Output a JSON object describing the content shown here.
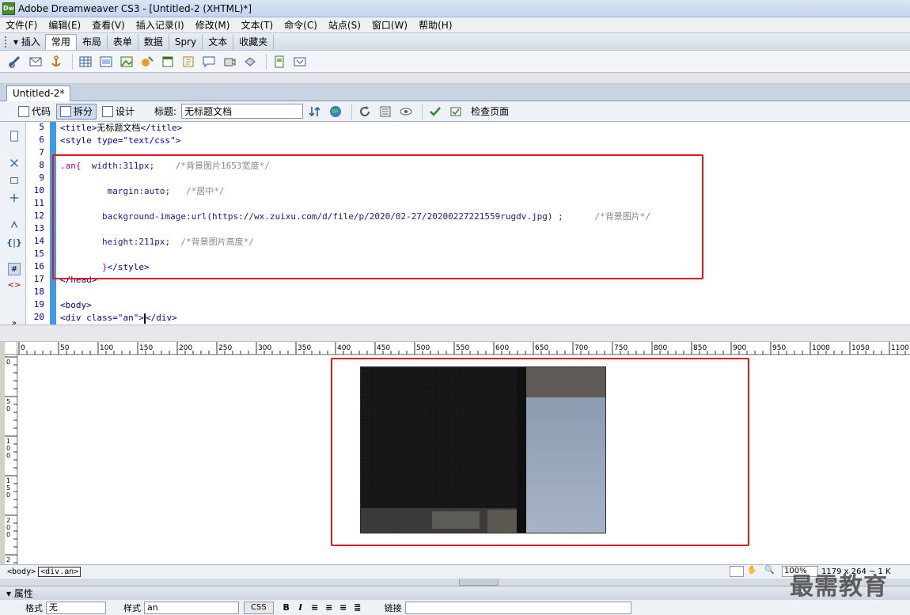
{
  "window": {
    "title": "Adobe Dreamweaver CS3 - [Untitled-2 (XHTML)*]",
    "icon_text": "Dw"
  },
  "menu": [
    "文件(F)",
    "编辑(E)",
    "查看(V)",
    "插入记录(I)",
    "修改(M)",
    "文本(T)",
    "命令(C)",
    "站点(S)",
    "窗口(W)",
    "帮助(H)"
  ],
  "insert_panel": {
    "label": "▾ 插入",
    "tabs": [
      "常用",
      "布局",
      "表单",
      "数据",
      "Spry",
      "文本",
      "收藏夹"
    ],
    "active_tab": "常用"
  },
  "document": {
    "tab": "Untitled-2*",
    "views": {
      "code": "代码",
      "split": "拆分",
      "design": "设计"
    },
    "title_label": "标题:",
    "title_value": "无标题文档",
    "check_page": "检查页面"
  },
  "code": {
    "line_numbers": [
      "5",
      "6",
      "7",
      "8",
      "9",
      "10",
      "11",
      "12",
      "13",
      "14",
      "15",
      "16",
      "17",
      "18",
      "19",
      "20"
    ],
    "lines": {
      "l5": {
        "open": "<title>",
        "text": "无标题文档",
        "close": "</title>"
      },
      "l6": {
        "open": "<style ",
        "attr": "type=",
        "val": "\"text/css\"",
        "end": ">"
      },
      "l8": {
        "sel": ".an{  ",
        "prop": "width:311px;",
        "cmt": "    /*背景图片1653宽度*/"
      },
      "l10": {
        "prop": "         margin:auto;",
        "cmt": "   /*居中*/"
      },
      "l12": {
        "prop": "        background-image:url(https://wx.zuixu.com/d/file/p/2020/02-27/20200227221559rugdv.jpg) ;",
        "cmt": "      /*背景图片*/"
      },
      "l14": {
        "prop": "        height:211px;",
        "cmt": "  /*背景图片高度*/"
      },
      "l16": {
        "sel": "        }",
        "close": "</style>"
      },
      "l17": "</head>",
      "l19": "<body>",
      "l20": {
        "open": "<div class=",
        "val": "\"an\"",
        "mid": ">",
        "close": "</div>"
      }
    }
  },
  "ruler": {
    "h_labels": [
      "0",
      "50",
      "100",
      "150",
      "200",
      "250",
      "300",
      "350",
      "400",
      "450",
      "500",
      "550",
      "600",
      "650",
      "700",
      "750",
      "800",
      "850",
      "900",
      "950",
      "1000",
      "1050",
      "1100"
    ],
    "v_labels": [
      "0",
      "5\n0",
      "1\n0\n0",
      "1\n5\n0",
      "2\n0\n0",
      "2"
    ]
  },
  "status": {
    "crumbs": [
      "<body>",
      "<div.an>"
    ],
    "zoom": "100%",
    "size": "1179 x 264 ~ 1 K"
  },
  "properties": {
    "title": "▾ 属性",
    "format_label": "格式",
    "format_value": "无",
    "style_label": "样式",
    "style_value": "an",
    "css_button": "CSS",
    "bold": "B",
    "italic": "I",
    "link_label": "链接"
  },
  "watermark": "最需教育",
  "colors": {
    "annotation": "#e1161d",
    "code_fold_strip": "#3f98e8"
  }
}
